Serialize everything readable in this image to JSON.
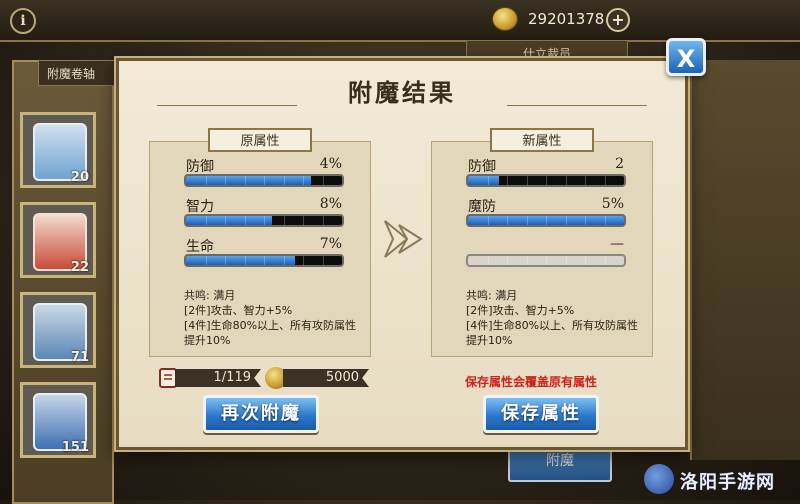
{
  "header": {
    "gold": "29201378",
    "plus_label": "+",
    "info_label": "i"
  },
  "background": {
    "left_tab_label": "附魔卷轴",
    "right_tab_label": "仕立裁员",
    "bottom_button_label": "附魔",
    "scroll_counts": [
      "20",
      "22",
      "71",
      "151"
    ]
  },
  "dialog": {
    "title": "附魔结果",
    "close_label": "X",
    "original": {
      "header": "原属性",
      "stats": [
        {
          "name": "防御",
          "value": "4%",
          "fill": 0.8
        },
        {
          "name": "智力",
          "value": "8%",
          "fill": 0.55
        },
        {
          "name": "生命",
          "value": "7%",
          "fill": 0.7
        }
      ],
      "set_name": "共鸣: 满月",
      "set_lines": [
        "[2件]攻击、智力+5%",
        "[4件]生命80%以上、所有攻防属性",
        "提升10%"
      ]
    },
    "new": {
      "header": "新属性",
      "stats": [
        {
          "name": "防御",
          "value": "2",
          "fill": 0.2
        },
        {
          "name": "魔防",
          "value": "5%",
          "fill": 1.0
        },
        {
          "name": "",
          "value": "—",
          "fill": 0
        }
      ],
      "set_name": "共鸣: 满月",
      "set_lines": [
        "[2件]攻击、智力+5%",
        "[4件]生命80%以上、所有攻防属性",
        "提升10%"
      ]
    },
    "scroll_cost": "1/119",
    "gold_cost": "5000",
    "warning": "保存属性会覆盖原有属性",
    "retry_label": "再次附魔",
    "save_label": "保存属性"
  },
  "watermark": {
    "text": "洛阳手游网"
  },
  "colors": {
    "accent_blue": "#2e78cc",
    "warning_red": "#d0221a",
    "parchment": "#f3ead6"
  }
}
